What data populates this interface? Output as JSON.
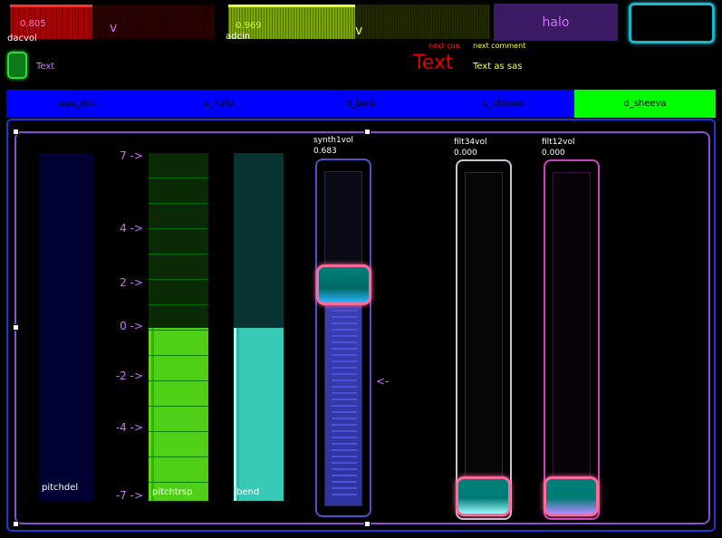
{
  "meters": {
    "dacvol": {
      "label": "dacvol",
      "value_text": "0.805",
      "caret": "v",
      "value": 0.805,
      "fill": "#c00000",
      "peak": "#ff3030"
    },
    "adcin": {
      "label": "adcin",
      "value_text": "0.969",
      "caret": "v",
      "value": 0.969,
      "fill": "#8fc400",
      "peak": "#e8ff40"
    }
  },
  "halo_button": {
    "label": "halo"
  },
  "toggle_label": "Text",
  "cue": {
    "next_cue_label": "next cue",
    "next_comment_label": "next comment",
    "text": "Text",
    "comment": "Text as sas"
  },
  "tabs": [
    {
      "label": "aaa_init",
      "active": false
    },
    {
      "label": "a_halo",
      "active": false
    },
    {
      "label": "b_bulb",
      "active": false
    },
    {
      "label": "c_chrono",
      "active": false
    },
    {
      "label": "d_sheeva",
      "active": true
    }
  ],
  "scale": {
    "labels": [
      "7 ->",
      "4 ->",
      "2 ->",
      "0 ->",
      "-2 ->",
      "-4 ->",
      "-7 ->"
    ],
    "arrow": "<-"
  },
  "bars": {
    "pitchdel": {
      "label": "pitchdel"
    },
    "pitchtrsp": {
      "label": "pitchtrsp"
    },
    "bend": {
      "label": "bend"
    }
  },
  "faders": {
    "synth1vol": {
      "name": "synth1vol",
      "value_text": "0.683",
      "value": 0.683
    },
    "filt34vol": {
      "name": "filt34vol",
      "value_text": "0.000",
      "value": 0.0
    },
    "filt12vol": {
      "name": "filt12vol",
      "value_text": "0.000",
      "value": 0.0
    }
  },
  "colors": {
    "accent_green": "#00ff00",
    "tab_blue": "#0000ff",
    "scale_purple": "#d070ff",
    "knob_pink": "#ff6a9a"
  }
}
